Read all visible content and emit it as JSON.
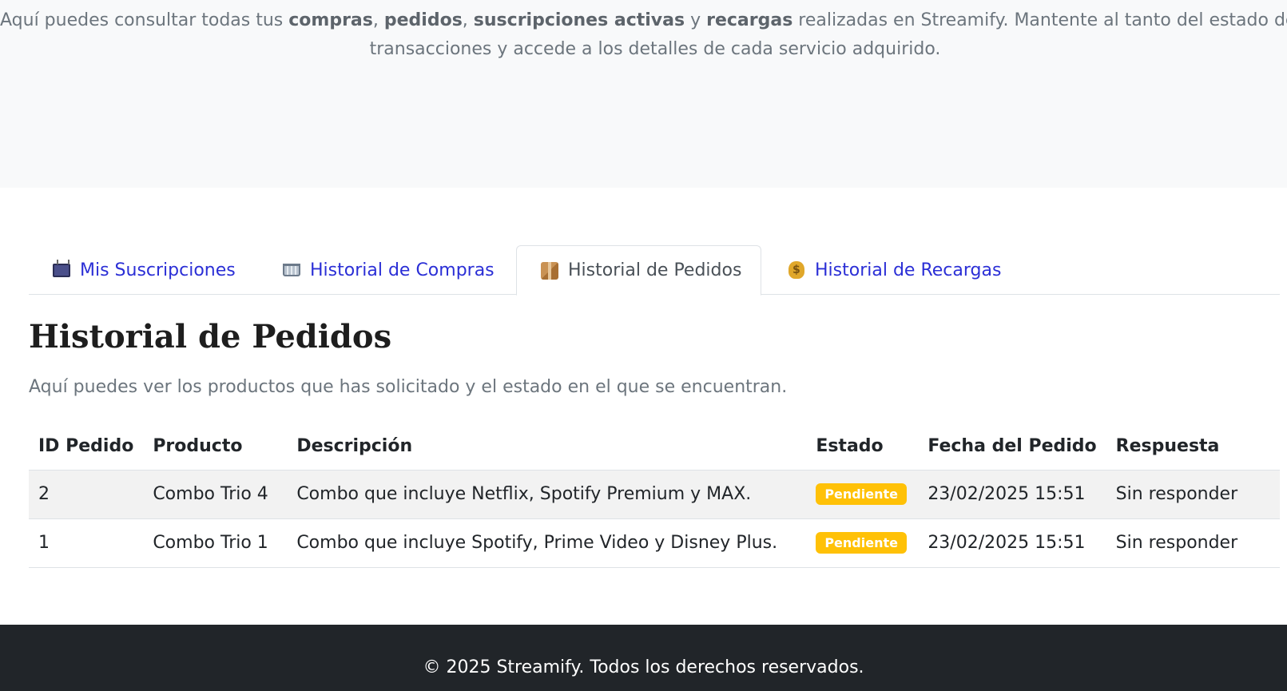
{
  "hero": {
    "t1": "Aquí puedes consultar todas tus ",
    "b1": "compras",
    "t2": ", ",
    "b2": "pedidos",
    "t3": ", ",
    "b3": "suscripciones activas",
    "t4": " y ",
    "b4": "recargas",
    "t5": " realizadas en Streamify. Mantente al tanto del estado de tus",
    "line2": "transacciones y accede a los detalles de cada servicio adquirido."
  },
  "tabs": [
    {
      "label": "Mis Suscripciones",
      "icon": "tv-icon",
      "active": false
    },
    {
      "label": "Historial de Compras",
      "icon": "shopping-cart-icon",
      "active": false
    },
    {
      "label": "Historial de Pedidos",
      "icon": "package-icon",
      "active": true
    },
    {
      "label": "Historial de Recargas",
      "icon": "money-bag-icon",
      "active": false
    }
  ],
  "section": {
    "title": "Historial de Pedidos",
    "subtitle": "Aquí puedes ver los productos que has solicitado y el estado en el que se encuentran."
  },
  "table": {
    "headers": [
      "ID Pedido",
      "Producto",
      "Descripción",
      "Estado",
      "Fecha del Pedido",
      "Respuesta"
    ],
    "rows": [
      {
        "id": "2",
        "product": "Combo Trio 4",
        "description": "Combo que incluye Netflix, Spotify Premium y MAX.",
        "status": "Pendiente",
        "date": "23/02/2025 15:51",
        "response": "Sin responder"
      },
      {
        "id": "1",
        "product": "Combo Trio 1",
        "description": "Combo que incluye Spotify, Prime Video y Disney Plus.",
        "status": "Pendiente",
        "date": "23/02/2025 15:51",
        "response": "Sin responder"
      }
    ]
  },
  "colors": {
    "link": "#2b2fd6",
    "badge_pending": "#ffc107",
    "footer_bg": "#212529"
  },
  "footer": {
    "text": "© 2025 Streamify. Todos los derechos reservados."
  }
}
